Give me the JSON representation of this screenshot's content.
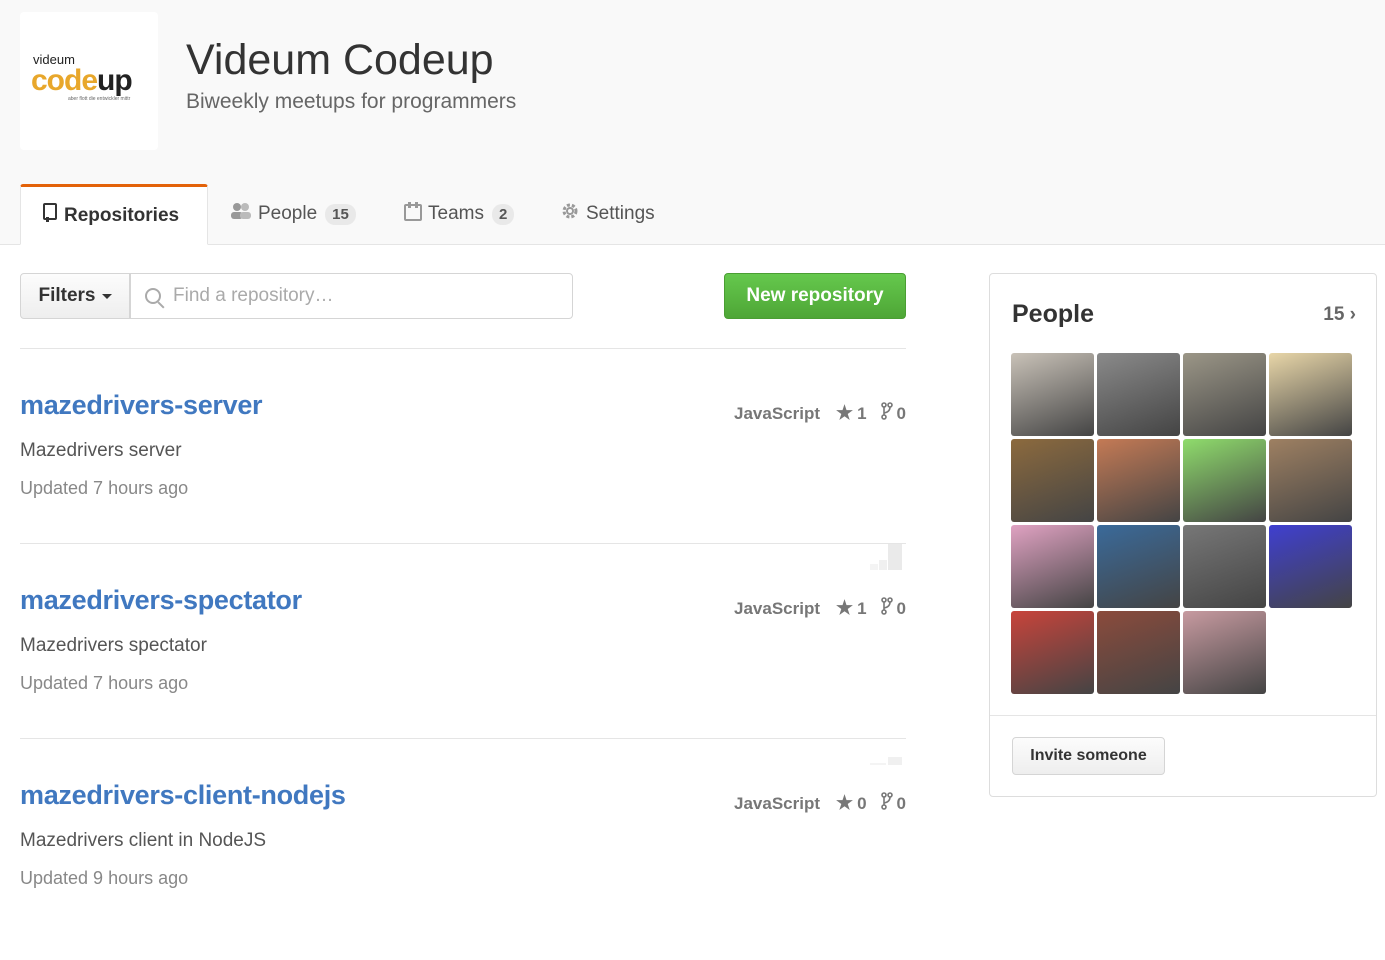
{
  "org": {
    "name": "Videum Codeup",
    "description": "Biweekly meetups for programmers",
    "logo": {
      "small": "videum",
      "main_light": "code",
      "main_dark": "up",
      "tagline": "aber flott die entwickler mittr"
    }
  },
  "tabs": [
    {
      "label": "Repositories",
      "icon": "repo-icon",
      "selected": true
    },
    {
      "label": "People",
      "count": "15",
      "icon": "people-icon"
    },
    {
      "label": "Teams",
      "count": "2",
      "icon": "teams-icon"
    },
    {
      "label": "Settings",
      "icon": "gear-icon"
    }
  ],
  "toolbar": {
    "filters_label": "Filters",
    "search_placeholder": "Find a repository…",
    "new_repo_label": "New repository"
  },
  "repos": [
    {
      "name": "mazedrivers-server",
      "description": "Mazedrivers server",
      "updated": "Updated 7 hours ago",
      "language": "JavaScript",
      "stars": "1",
      "forks": "0"
    },
    {
      "name": "mazedrivers-spectator",
      "description": "Mazedrivers spectator",
      "updated": "Updated 7 hours ago",
      "language": "JavaScript",
      "stars": "1",
      "forks": "0"
    },
    {
      "name": "mazedrivers-client-nodejs",
      "description": "Mazedrivers client in NodeJS",
      "updated": "Updated 9 hours ago",
      "language": "JavaScript",
      "stars": "0",
      "forks": "0"
    }
  ],
  "people": {
    "title": "People",
    "count": "15",
    "invite_label": "Invite someone",
    "avatar_colors": [
      "#c9c2b8",
      "#8a8a8a",
      "#9b9687",
      "#e8d6a8",
      "#8c6a3e",
      "#c47a55",
      "#8fdc6c",
      "#9e8062",
      "#e0a2c2",
      "#3a6a9a",
      "#777",
      "#3f3fd0",
      "#c8443b",
      "#8b4b3c",
      "#c79aa0"
    ]
  },
  "colors": {
    "link": "#4078c0",
    "accent": "#e36209",
    "button_green": "#55b83e",
    "logo_orange": "#e8a72b"
  }
}
